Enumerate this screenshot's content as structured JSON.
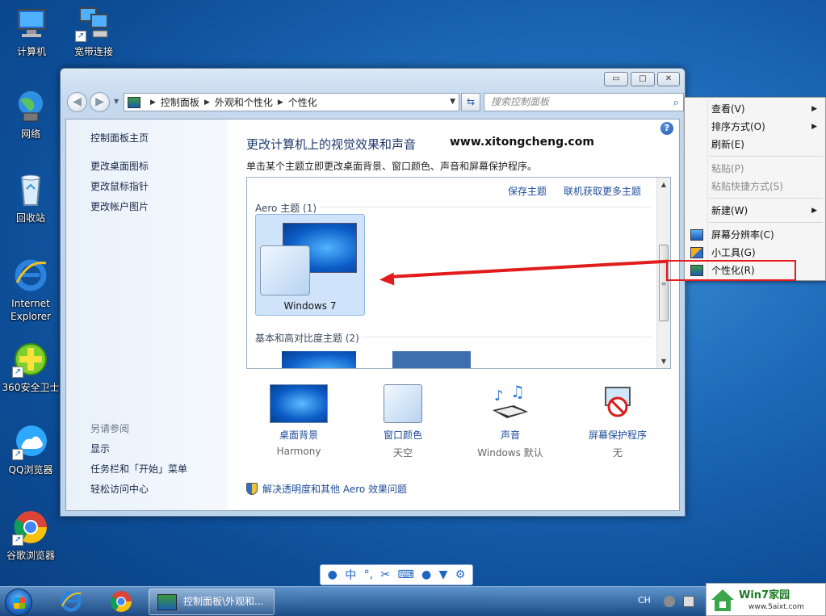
{
  "desktop": {
    "icons": [
      {
        "label": "计算机"
      },
      {
        "label": "宽带连接"
      },
      {
        "label": "网络"
      },
      {
        "label": "回收站"
      },
      {
        "label": "Internet Explorer"
      },
      {
        "label": "360安全卫士"
      },
      {
        "label": "QQ浏览器"
      },
      {
        "label": "谷歌浏览器"
      }
    ]
  },
  "window": {
    "buttons": {
      "minimize": "▭",
      "maximize": "□",
      "close": "✕"
    },
    "address": {
      "segments": [
        "控制面板",
        "外观和个性化",
        "个性化"
      ]
    },
    "search": {
      "placeholder": "搜索控制面板"
    },
    "sidebar": {
      "home": "控制面板主页",
      "links": [
        "更改桌面图标",
        "更改鼠标指针",
        "更改帐户图片"
      ],
      "see_also_heading": "另请参阅",
      "see_also": [
        "显示",
        "任务栏和「开始」菜单",
        "轻松访问中心"
      ]
    },
    "main": {
      "title": "更改计算机上的视觉效果和声音",
      "watermark_url": "www.xitongcheng.com",
      "description": "单击某个主题立即更改桌面背景、窗口颜色、声音和屏幕保护程序。",
      "save_theme": "保存主题",
      "get_more": "联机获取更多主题",
      "aero_heading": "Aero 主题 (1)",
      "aero_theme_name": "Windows 7",
      "basic_heading": "基本和高对比度主题 (2)",
      "options": [
        {
          "label": "桌面背景",
          "value": "Harmony"
        },
        {
          "label": "窗口颜色",
          "value": "天空"
        },
        {
          "label": "声音",
          "value": "Windows 默认"
        },
        {
          "label": "屏幕保护程序",
          "value": "无"
        }
      ],
      "help_link": "解决透明度和其他 Aero 效果问题"
    }
  },
  "context_menu": {
    "items": [
      {
        "label": "查看(V)"
      },
      {
        "label": "排序方式(O)"
      },
      {
        "label": "刷新(E)"
      },
      {
        "label": "粘贴(P)"
      },
      {
        "label": "粘贴快捷方式(S)"
      },
      {
        "label": "新建(W)"
      },
      {
        "label": "屏幕分辨率(C)"
      },
      {
        "label": "小工具(G)"
      },
      {
        "label": "个性化(R)"
      }
    ]
  },
  "ime_bar": {
    "lang": "中"
  },
  "taskbar": {
    "task_label": "控制面板\\外观和...",
    "lang": "CH"
  },
  "watermark": {
    "title": "Win7家园",
    "url": "www.5aixt.com"
  },
  "colors": {
    "link": "#1e4c9a",
    "highlight": "#e6191d",
    "title": "#1c3a6e"
  }
}
